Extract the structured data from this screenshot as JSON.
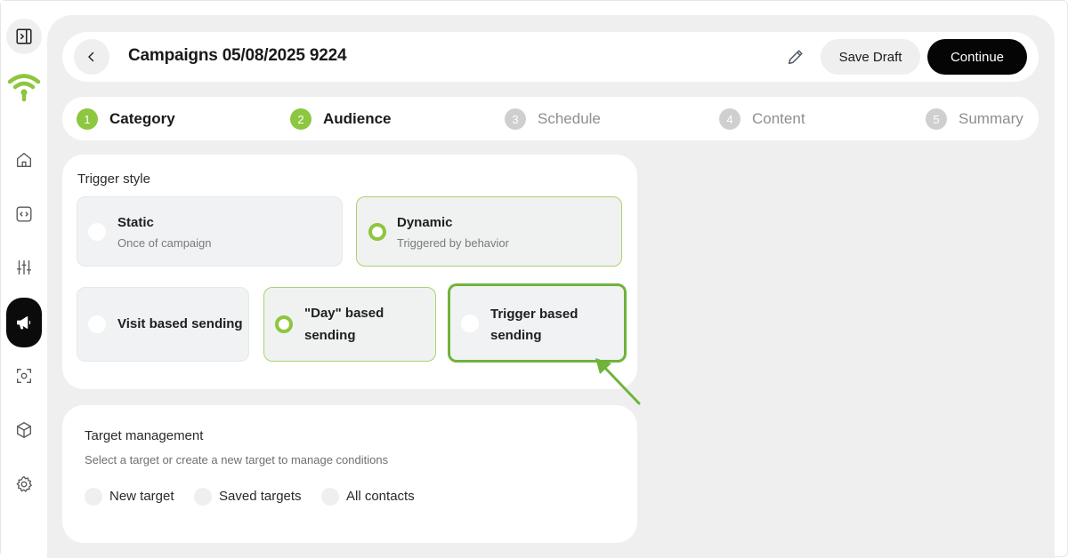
{
  "header": {
    "title": "Campaigns 05/08/2025 9224",
    "save_label": "Save Draft",
    "continue_label": "Continue"
  },
  "steps": [
    {
      "num": "1",
      "label": "Category",
      "state": "done"
    },
    {
      "num": "2",
      "label": "Audience",
      "state": "done"
    },
    {
      "num": "3",
      "label": "Schedule",
      "state": "todo"
    },
    {
      "num": "4",
      "label": "Content",
      "state": "todo"
    },
    {
      "num": "5",
      "label": "Summary",
      "state": "todo"
    }
  ],
  "trigger": {
    "title": "Trigger style",
    "static": {
      "title": "Static",
      "sub": "Once of campaign"
    },
    "dynamic": {
      "title": "Dynamic",
      "sub": "Triggered by behavior"
    },
    "visit": {
      "title": "Visit based sending"
    },
    "day": {
      "title_line1": "\"Day\" based",
      "title_line2": "sending"
    },
    "triggerbased": {
      "title_line1": "Trigger based",
      "title_line2": "sending"
    }
  },
  "target": {
    "title": "Target management",
    "sub": "Select a target or create a new target to manage conditions",
    "options": [
      "New target",
      "Saved targets",
      "All contacts"
    ]
  },
  "sidebar": {
    "icons": [
      "sidebar-toggle-icon",
      "wifi-logo",
      "home-icon",
      "code-icon",
      "sliders-icon",
      "megaphone-icon",
      "scan-icon",
      "cube-icon",
      "gear-icon"
    ]
  },
  "colors": {
    "accent_green": "#8dc63f",
    "highlight_green": "#6fb33c",
    "dark": "#050505",
    "background": "#efefef"
  }
}
